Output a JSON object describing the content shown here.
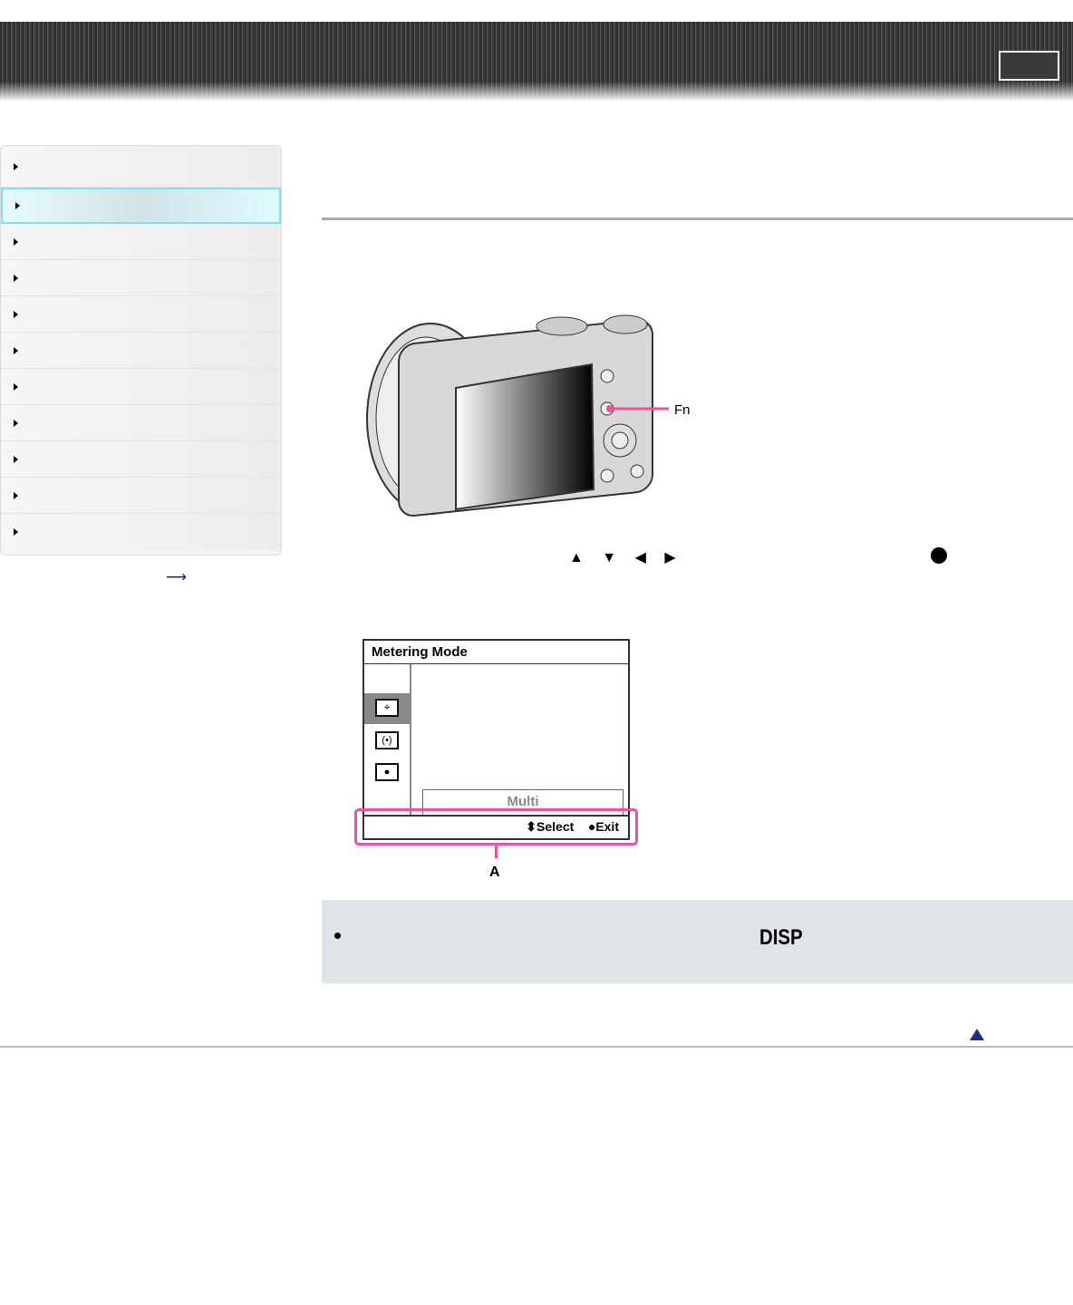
{
  "sidebar": {
    "items": [
      {
        "active": false
      },
      {
        "active": true
      },
      {
        "active": false
      },
      {
        "active": false
      },
      {
        "active": false
      },
      {
        "active": false
      },
      {
        "active": false
      },
      {
        "active": false
      },
      {
        "active": false
      },
      {
        "active": false
      },
      {
        "active": false
      }
    ]
  },
  "illustration": {
    "callout_fn": "Fn"
  },
  "instructions": {
    "arrows": "▲ ▼ ◀ ▶"
  },
  "screen": {
    "title": "Metering Mode",
    "selected": "Multi",
    "select_label": "Select",
    "exit_label": "Exit",
    "callout": "A"
  },
  "note": {
    "disp_label": "DISP"
  },
  "colors": {
    "accent": "#f050a0",
    "active_nav": "#7fe0f6"
  }
}
